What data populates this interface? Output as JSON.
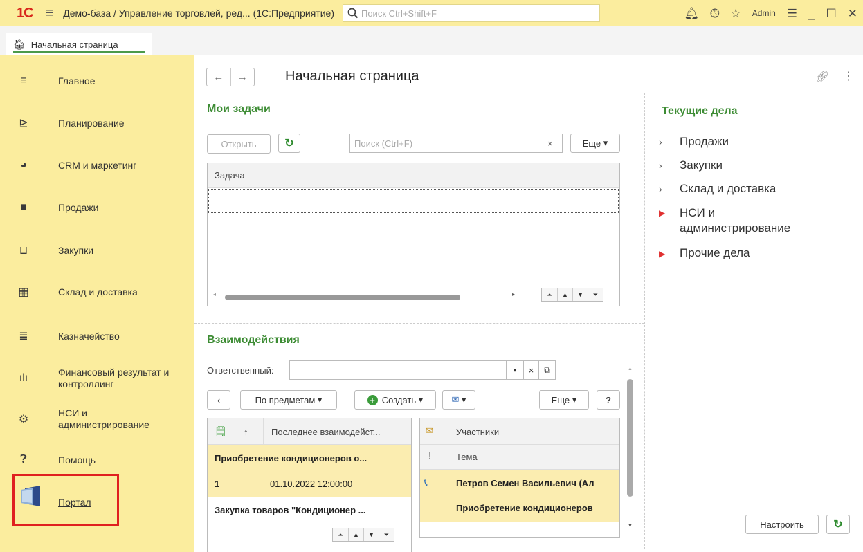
{
  "titlebar": {
    "logo": "1С",
    "title": "Демо-база / Управление торговлей, ред... (1С:Предприятие)",
    "search_placeholder": "Поиск Ctrl+Shift+F",
    "user": "Admin"
  },
  "tabs": [
    {
      "label": "Начальная страница"
    }
  ],
  "sidebar": {
    "items": [
      {
        "label": "Главное",
        "icon": "menu-icon"
      },
      {
        "label": "Планирование",
        "icon": "planning-icon"
      },
      {
        "label": "CRM и маркетинг",
        "icon": "pie-chart-icon"
      },
      {
        "label": "Продажи",
        "icon": "shopping-bag-icon"
      },
      {
        "label": "Закупки",
        "icon": "cart-icon"
      },
      {
        "label": "Склад и доставка",
        "icon": "warehouse-icon"
      },
      {
        "label": "Казначейство",
        "icon": "coins-icon"
      },
      {
        "label": "Финансовый результат и контроллинг",
        "icon": "bar-chart-icon"
      },
      {
        "label": "НСИ и администрирование",
        "icon": "gear-icon"
      },
      {
        "label": "Помощь",
        "icon": "help-icon"
      }
    ],
    "portal_label": "Портал"
  },
  "main": {
    "title": "Начальная страница",
    "tasks": {
      "title": "Мои задачи",
      "open_label": "Открыть",
      "search_placeholder": "Поиск (Ctrl+F)",
      "more_label": "Еще",
      "column_header": "Задача"
    },
    "interactions": {
      "title": "Взаимодействия",
      "responsible_label": "Ответственный:",
      "by_subjects_label": "По предметам",
      "create_label": "Создать",
      "more_label": "Еще",
      "help_label": "?",
      "left_header": "Последнее взаимодейст...",
      "left_rows": [
        {
          "text": "Приобретение кондиционеров о..."
        },
        {
          "num": "1",
          "date": "01.10.2022 12:00:00"
        },
        {
          "text": "Закупка товаров \"Кондиционер ..."
        }
      ],
      "right_header_1": "Участники",
      "right_header_2": "Тема",
      "right_rows": [
        {
          "text": "Петров Семен Васильевич (Ал"
        },
        {
          "text": "Приобретение кондиционеров"
        }
      ]
    },
    "current": {
      "title": "Текущие дела",
      "items": [
        {
          "label": "Продажи",
          "style": "chevron"
        },
        {
          "label": "Закупки",
          "style": "chevron"
        },
        {
          "label": "Склад и доставка",
          "style": "chevron"
        },
        {
          "label": "НСИ и администрирование",
          "style": "triangle"
        },
        {
          "label": "Прочие дела",
          "style": "triangle"
        }
      ],
      "configure_label": "Настроить"
    }
  },
  "colors": {
    "accent_green": "#3d8c34",
    "panel_yellow": "#fbed9e",
    "highlight_row": "#fbedb0",
    "red_frame": "#e02020"
  }
}
